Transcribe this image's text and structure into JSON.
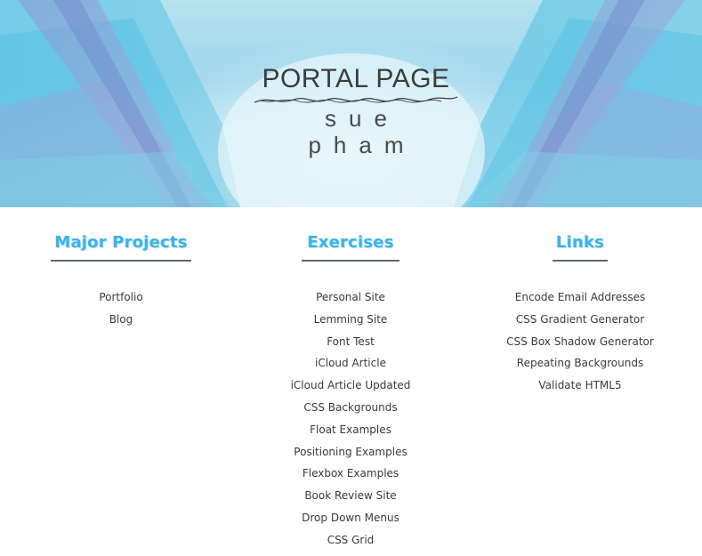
{
  "header": {
    "title": "PORTAL PAGE",
    "subtitle": "sue pham"
  },
  "colors": {
    "heading": "#3fb2e6",
    "link": "#3a3a3a",
    "underline": "#5b6b75"
  },
  "sections": [
    {
      "heading": "Major Projects",
      "links": [
        "Portfolio",
        "Blog"
      ]
    },
    {
      "heading": "Exercises",
      "links": [
        "Personal Site",
        "Lemming Site",
        "Font Test",
        "iCloud Article",
        "iCloud Article Updated",
        "CSS Backgrounds",
        "Float Examples",
        "Positioning Examples",
        "Flexbox Examples",
        "Book Review Site",
        "Drop Down Menus",
        "CSS Grid"
      ]
    },
    {
      "heading": "Links",
      "links": [
        "Encode Email Addresses",
        "CSS Gradient Generator",
        "CSS Box Shadow Generator",
        "Repeating Backgrounds",
        "Validate HTML5"
      ]
    }
  ]
}
